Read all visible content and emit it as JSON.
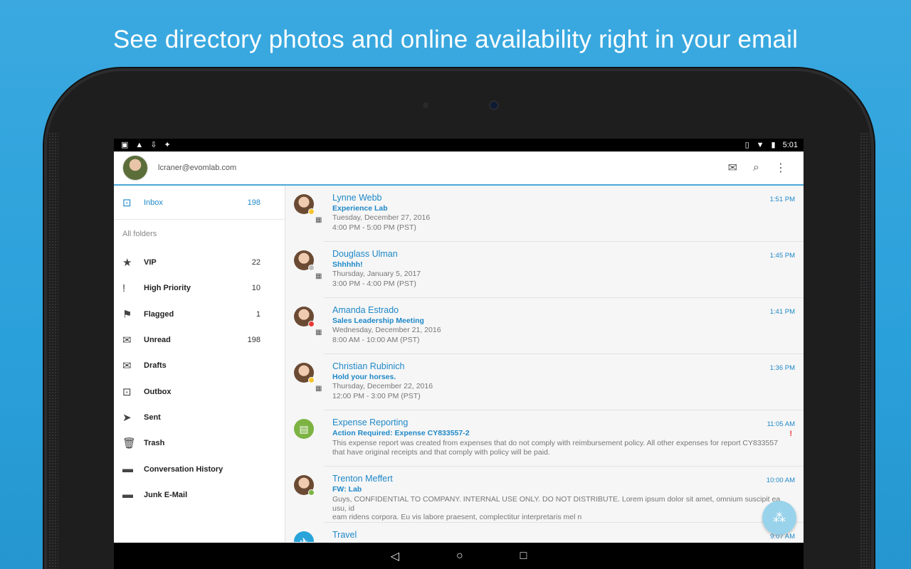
{
  "headline": "See directory photos and online availability right in your email",
  "statusbar": {
    "left_icons": [
      "image-icon",
      "warning-icon",
      "download-icon",
      "android-icon"
    ],
    "time": "5:01"
  },
  "appbar": {
    "account": "lcraner@evomlab.com",
    "actions": [
      "compose-icon",
      "search-icon",
      "more-icon"
    ]
  },
  "sidebar": {
    "inbox": {
      "label": "Inbox",
      "count": "198"
    },
    "all_folders": "All folders",
    "folders": [
      {
        "label": "VIP",
        "count": "22",
        "icon": "star-icon",
        "glyph": "★"
      },
      {
        "label": "High Priority",
        "count": "10",
        "icon": "exclamation-icon",
        "glyph": "!"
      },
      {
        "label": "Flagged",
        "count": "1",
        "icon": "flag-icon",
        "glyph": "⚑"
      },
      {
        "label": "Unread",
        "count": "198",
        "icon": "envelope-icon",
        "glyph": "✉"
      },
      {
        "label": "Drafts",
        "count": "",
        "icon": "drafts-icon",
        "glyph": "✉"
      },
      {
        "label": "Outbox",
        "count": "",
        "icon": "outbox-icon",
        "glyph": "⊡"
      },
      {
        "label": "Sent",
        "count": "",
        "icon": "send-icon",
        "glyph": "➤"
      },
      {
        "label": "Trash",
        "count": "",
        "icon": "trash-icon",
        "glyph": "🗑"
      },
      {
        "label": "Conversation History",
        "count": "",
        "icon": "folder-icon",
        "glyph": "▬"
      },
      {
        "label": "Junk E-Mail",
        "count": "",
        "icon": "folder-icon",
        "glyph": "▬"
      }
    ]
  },
  "messages": [
    {
      "sender": "Lynne Webb",
      "subject": "Experience Lab",
      "line1": "Tuesday, December 27, 2016",
      "line2": "4:00 PM - 5:00 PM (PST)",
      "time": "1:51 PM",
      "presence": "#f5c32c",
      "calendar": true
    },
    {
      "sender": "Douglass Ulman",
      "subject": "Shhhhh!",
      "line1": "Thursday, January 5, 2017",
      "line2": "3:00 PM - 4:00 PM (PST)",
      "time": "1:45 PM",
      "presence": "#bdbdbd",
      "calendar": true
    },
    {
      "sender": "Amanda Estrado",
      "subject": "Sales Leadership Meeting",
      "line1": "Wednesday, December 21, 2016",
      "line2": "8:00 AM - 10:00 AM (PST)",
      "time": "1:41 PM",
      "presence": "#e53935",
      "calendar": true
    },
    {
      "sender": "Christian Rubinich",
      "subject": "Hold your horses.",
      "line1": "Thursday, December 22, 2016",
      "line2": "12:00 PM - 3:00 PM (PST)",
      "time": "1:36 PM",
      "presence": "#f5c32c",
      "calendar": true
    },
    {
      "sender": "Expense Reporting",
      "subject": "Action Required: Expense CY833557-2",
      "line1": "This expense report was created from expenses that do not comply with reimbursement policy. All other expenses for report CY833557",
      "line2": "that have original receipts and that comply with policy will be paid.",
      "time": "11:05 AM",
      "presence": "",
      "calendar": false,
      "important": "!"
    },
    {
      "sender": "Trenton Meffert",
      "subject": "FW: Lab",
      "line1": "Guys, CONFIDENTIAL TO COMPANY. INTERNAL USE ONLY. DO NOT DISTRIBUTE. Lorem ipsum dolor sit amet, omnium suscipit ea usu, id",
      "line2": "eam ridens corpora. Eu vis labore praesent, complectitur interpretaris mel n",
      "time": "10:00 AM",
      "presence": "#7cb342",
      "calendar": false
    },
    {
      "sender": "Travel",
      "subject": "",
      "line1": "",
      "line2": "",
      "time": "9:07 AM",
      "presence": "",
      "calendar": false
    }
  ],
  "colors": {
    "accent": "#1e88c8",
    "background": "#2aa0da"
  }
}
